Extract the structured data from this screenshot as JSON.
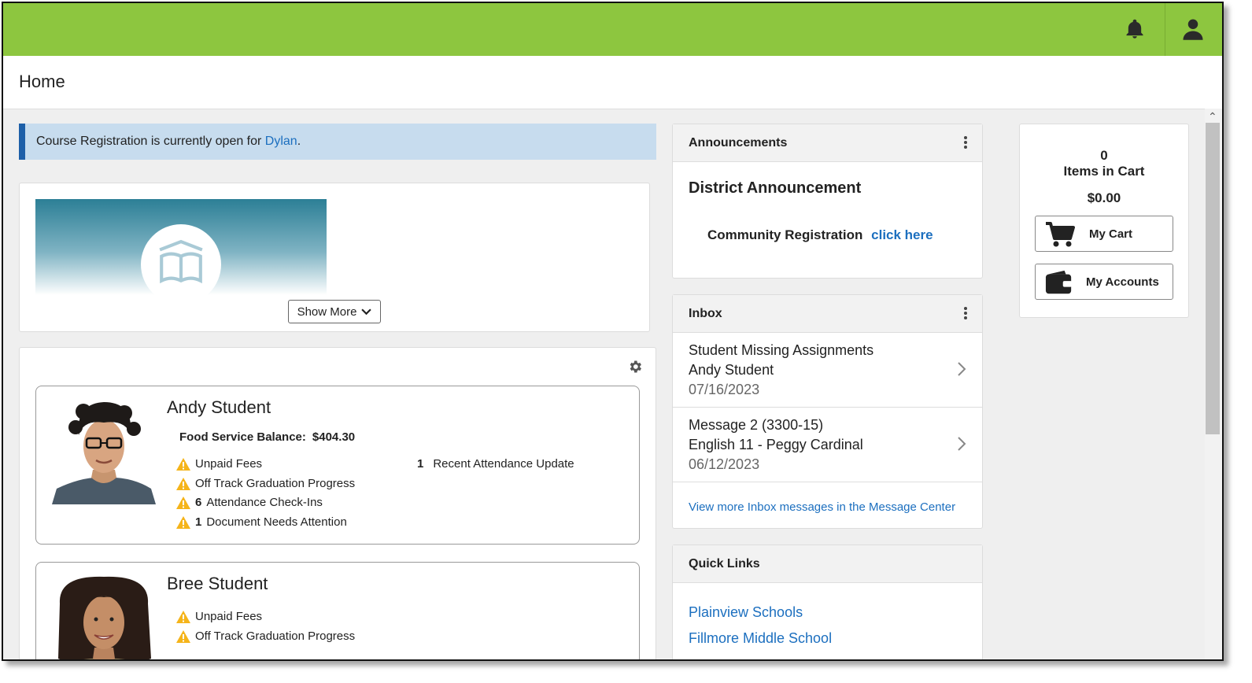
{
  "header": {
    "title": "Home"
  },
  "topbar": {
    "icons": [
      "bell-icon",
      "user-icon"
    ],
    "accent": "#8dc63f"
  },
  "notice": {
    "prefix": "Course Registration is currently open for ",
    "link": "Dylan",
    "suffix": "."
  },
  "banner": {
    "show_more_label": "Show More",
    "icon": "open-book-icon"
  },
  "students": [
    {
      "name": "Andy Student",
      "food_label": "Food Service Balance:",
      "food_amount": "$404.30",
      "alerts": [
        {
          "count": "",
          "text": "Unpaid Fees"
        },
        {
          "count": "",
          "text": "Off Track Graduation Progress"
        },
        {
          "count": "6",
          "text": "Attendance Check-Ins"
        },
        {
          "count": "1",
          "text": "Document Needs Attention"
        }
      ],
      "notes": [
        {
          "count": "1",
          "text": "Recent Attendance Update"
        }
      ]
    },
    {
      "name": "Bree Student",
      "alerts": [
        {
          "count": "",
          "text": "Unpaid Fees"
        },
        {
          "count": "",
          "text": "Off Track Graduation Progress"
        }
      ]
    }
  ],
  "announcements": {
    "title": "Announcements",
    "heading": "District Announcement",
    "text": "Community Registration",
    "link": "click here"
  },
  "inbox": {
    "title": "Inbox",
    "items": [
      {
        "subject": "Student Missing Assignments",
        "from": "Andy Student",
        "date": "07/16/2023"
      },
      {
        "subject": "Message 2 (3300-15)",
        "from": "English 11 - Peggy Cardinal",
        "date": "06/12/2023"
      }
    ],
    "view_more": "View more Inbox messages in the Message Center"
  },
  "quick_links": {
    "title": "Quick Links",
    "links": [
      "Plainview Schools",
      "Fillmore Middle School"
    ]
  },
  "cart": {
    "count": "0",
    "items_label": "Items in Cart",
    "total": "$0.00",
    "my_cart": "My Cart",
    "my_accounts": "My Accounts"
  }
}
